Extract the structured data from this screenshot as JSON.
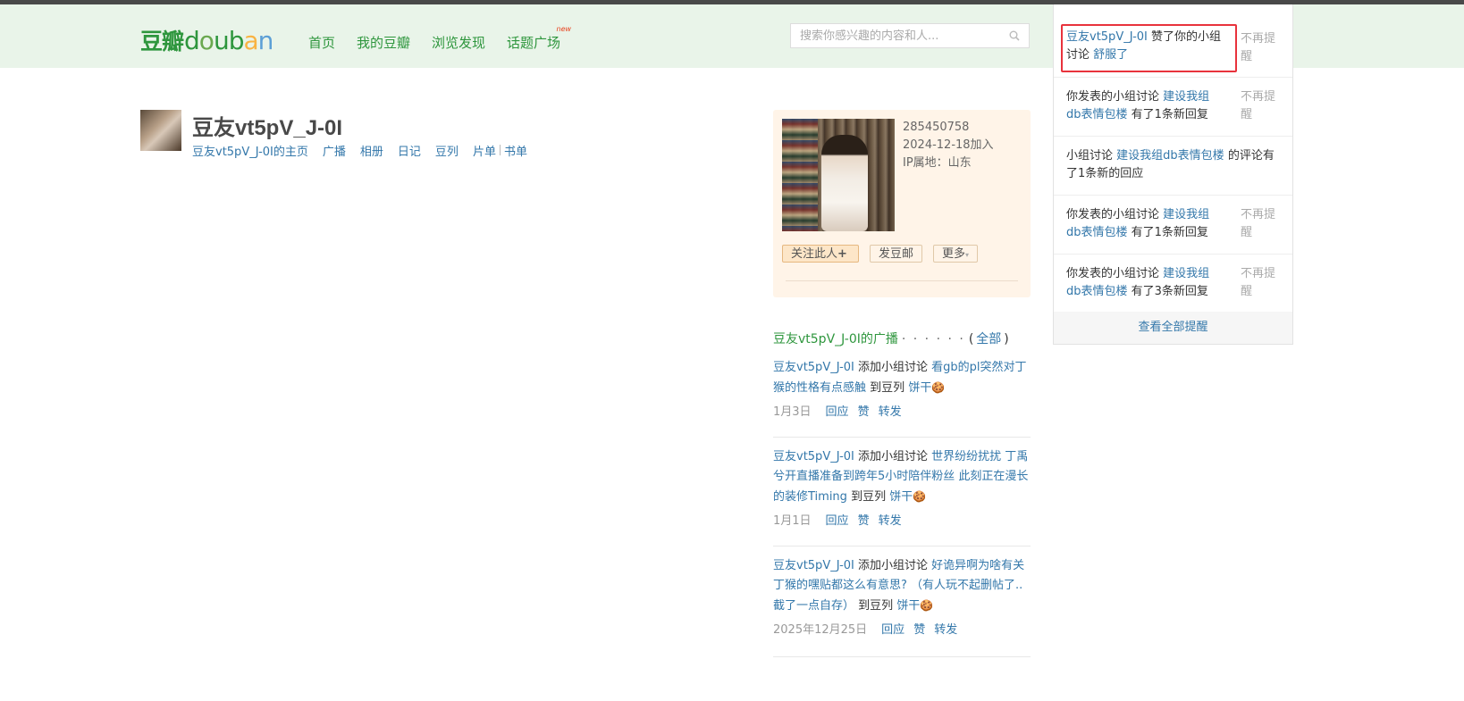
{
  "header": {
    "logo_cn": "豆瓣",
    "logo_en": {
      "d": "d",
      "o": "o",
      "u": "u",
      "b": "b",
      "a": "a",
      "n": "n"
    },
    "nav": [
      "首页",
      "我的豆瓣",
      "浏览发现",
      "话题广场"
    ],
    "new_badge": "new",
    "search_placeholder": "搜索你感兴趣的内容和人..."
  },
  "profile": {
    "name": "豆友vt5pV_J-0I",
    "links": [
      "豆友vt5pV_J-0I的主页",
      "广播",
      "相册",
      "日记",
      "豆列",
      "片单",
      "书单"
    ]
  },
  "card": {
    "id": "285450758",
    "joined": "2024-12-18加入",
    "ip": "IP属地：山东",
    "follow": "关注此人",
    "follow_plus": "+",
    "mail": "发豆邮",
    "more": "更多",
    "more_tri": "▾"
  },
  "feed": {
    "title": "豆友vt5pV_J-0I的广播",
    "dots": "· · · · · ·",
    "all_open": "(",
    "all": "全部",
    "all_close": ")",
    "items": [
      {
        "user": "豆友vt5pV_J-0I",
        "action": "添加小组讨论",
        "topic": "看gb的pl突然对丁猴的性格有点感触",
        "to": "到豆列",
        "list": "饼干",
        "emoji": "🍪",
        "date": "1月3日",
        "reply": "回应",
        "like": "赞",
        "share": "转发"
      },
      {
        "user": "豆友vt5pV_J-0I",
        "action": "添加小组讨论",
        "topic": "世界纷纷扰扰 丁禹兮开直播准备到跨年5小时陪伴粉丝 此刻正在漫长的装修Timing",
        "to": "到豆列",
        "list": "饼干",
        "emoji": "🍪",
        "date": "1月1日",
        "reply": "回应",
        "like": "赞",
        "share": "转发"
      },
      {
        "user": "豆友vt5pV_J-0I",
        "action": "添加小组讨论",
        "topic": "好诡异啊为啥有关丁猴的嘿贴都这么有意思? （有人玩不起删帖了..截了一点自存）",
        "to": "到豆列",
        "list": "饼干",
        "emoji": "🍪",
        "date": "2025年12月25日",
        "reply": "回应",
        "like": "赞",
        "share": "转发"
      }
    ]
  },
  "notifications": {
    "items": [
      {
        "link1": "豆友vt5pV_J-0I",
        "text1": "赞了你的小组讨论",
        "link2": "舒服了",
        "text2": "",
        "dismiss": "不再提醒"
      },
      {
        "text0": "你发表的小组讨论",
        "link1": "建设我组db表情包楼",
        "text1": "有了1条新回复",
        "dismiss": "不再提醒"
      },
      {
        "text0": "小组讨论",
        "link1": "建设我组db表情包楼",
        "text1": "的评论有了1条新的回应",
        "dismiss": ""
      },
      {
        "text0": "你发表的小组讨论",
        "link1": "建设我组db表情包楼",
        "text1": "有了1条新回复",
        "dismiss": "不再提醒"
      },
      {
        "text0": "你发表的小组讨论",
        "link1": "建设我组db表情包楼",
        "text1": "有了3条新回复",
        "dismiss": "不再提醒"
      }
    ],
    "view_all": "查看全部提醒"
  },
  "colors": {
    "brand_green": "#2e963d",
    "link_blue": "#3377aa",
    "highlight_red": "#e8323c",
    "card_bg": "#fff4e8"
  }
}
